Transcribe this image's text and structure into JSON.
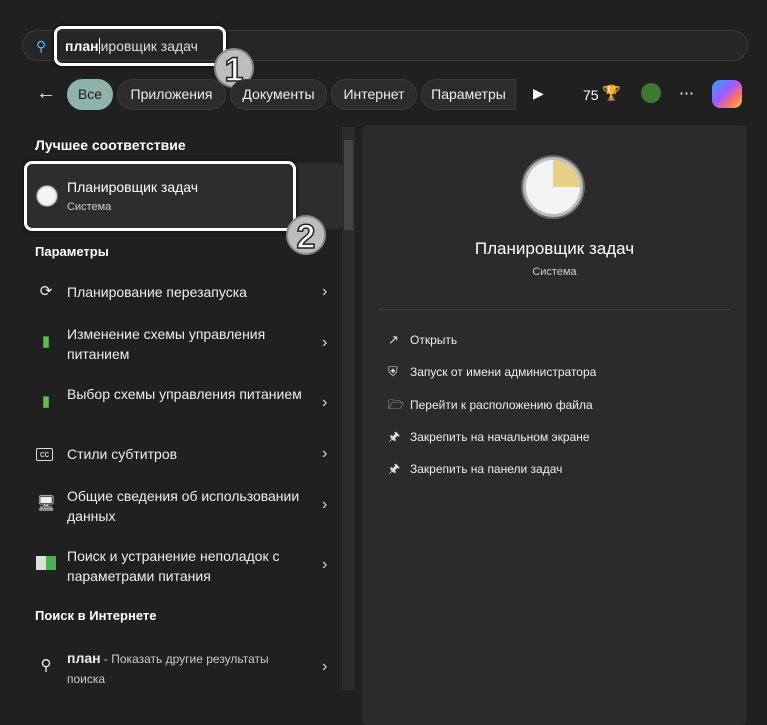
{
  "search": {
    "typed": "план",
    "completion": "ировщик задач"
  },
  "annotations": [
    "1",
    "2"
  ],
  "filters": [
    {
      "label": "Все",
      "active": true
    },
    {
      "label": "Приложения"
    },
    {
      "label": "Документы"
    },
    {
      "label": "Интернет"
    },
    {
      "label": "Параметры"
    }
  ],
  "points": "75",
  "best_match": {
    "header": "Лучшее соответствие",
    "title": "Планировщик задач",
    "subtitle": "Система"
  },
  "settings": {
    "header": "Параметры",
    "items": [
      {
        "label": "Планирование перезапуска",
        "icon": "restart-icon"
      },
      {
        "label": "Изменение схемы управления питанием",
        "icon": "power-plan-icon"
      },
      {
        "label": "Выбор схемы управления питанием",
        "icon": "power-plan-icon"
      },
      {
        "label": "Стили субтитров",
        "icon": "cc-icon"
      },
      {
        "label": "Общие сведения об использовании данных",
        "icon": "data-usage-icon"
      },
      {
        "label": "Поиск и устранение неполадок с параметрами питания",
        "icon": "troubleshoot-icon"
      }
    ]
  },
  "web": {
    "header": "Поиск в Интернете",
    "query": "план",
    "suffix": " - Показать другие результаты поиска"
  },
  "detail": {
    "title": "Планировщик задач",
    "subtitle": "Система",
    "actions": [
      "Открыть",
      "Запуск от имени администратора",
      "Перейти к расположению файла",
      "Закрепить на начальном экране",
      "Закрепить на панели задач"
    ]
  },
  "colors": {
    "accent": "#8fb3ab",
    "bg": "#202020",
    "panel": "#2b2b2b"
  }
}
